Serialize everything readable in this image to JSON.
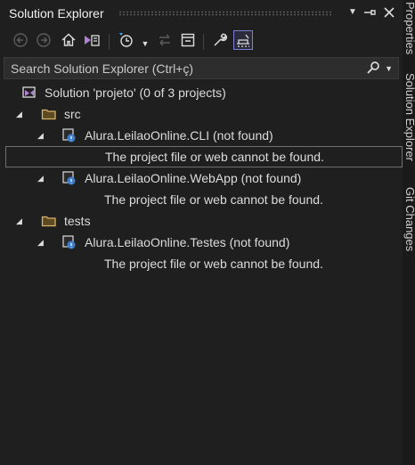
{
  "window": {
    "title": "Solution Explorer"
  },
  "search": {
    "placeholder": "Search Solution Explorer (Ctrl+ç)"
  },
  "tree": {
    "solution": "Solution 'projeto' (0 of 3 projects)",
    "folders": [
      {
        "label": "src"
      },
      {
        "label": "tests"
      }
    ],
    "projects": [
      {
        "label": "Alura.LeilaoOnline.CLI (not found)",
        "message": "The project file or web cannot be found."
      },
      {
        "label": "Alura.LeilaoOnline.WebApp (not found)",
        "message": "The project file or web cannot be found."
      },
      {
        "label": "Alura.LeilaoOnline.Testes (not found)",
        "message": "The project file or web cannot be found."
      }
    ]
  },
  "side_tabs": [
    "Properties",
    "Solution Explorer",
    "Git Changes"
  ],
  "colors": {
    "accent": "#7b7fd1",
    "folder": "#d8b46a",
    "background": "#1f1f1f"
  }
}
